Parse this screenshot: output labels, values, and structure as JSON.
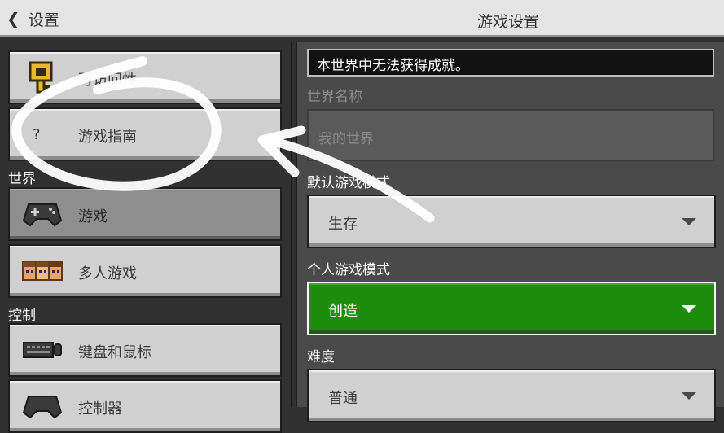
{
  "header": {
    "back_label": "设置",
    "title": "游戏设置"
  },
  "sidebar": {
    "items_top": [
      {
        "label": "可访问性",
        "icon": "key-icon"
      },
      {
        "label": "游戏指南",
        "icon": "question-icon",
        "icon_glyph": "?"
      }
    ],
    "section_world": "世界",
    "items_world": [
      {
        "label": "游戏",
        "icon": "gamepad-icon",
        "selected": true
      },
      {
        "label": "多人游戏",
        "icon": "players-icon"
      }
    ],
    "section_controls": "控制",
    "items_controls": [
      {
        "label": "键盘和鼠标",
        "icon": "keyboard-icon"
      },
      {
        "label": "控制器",
        "icon": "controller-icon"
      }
    ]
  },
  "main": {
    "notice": "本世界中无法获得成就。",
    "world_name_label": "世界名称",
    "world_name_value": "我的世界",
    "default_mode_label": "默认游戏模式",
    "default_mode_value": "生存",
    "personal_mode_label": "个人游戏模式",
    "personal_mode_value": "创造",
    "difficulty_label": "难度",
    "difficulty_value": "普通"
  },
  "colors": {
    "background": "#313131",
    "panel": "#4a4a4a",
    "button": "#d0d0d0",
    "accent_green": "#1e8d0b",
    "annotation": "#ffffff"
  }
}
